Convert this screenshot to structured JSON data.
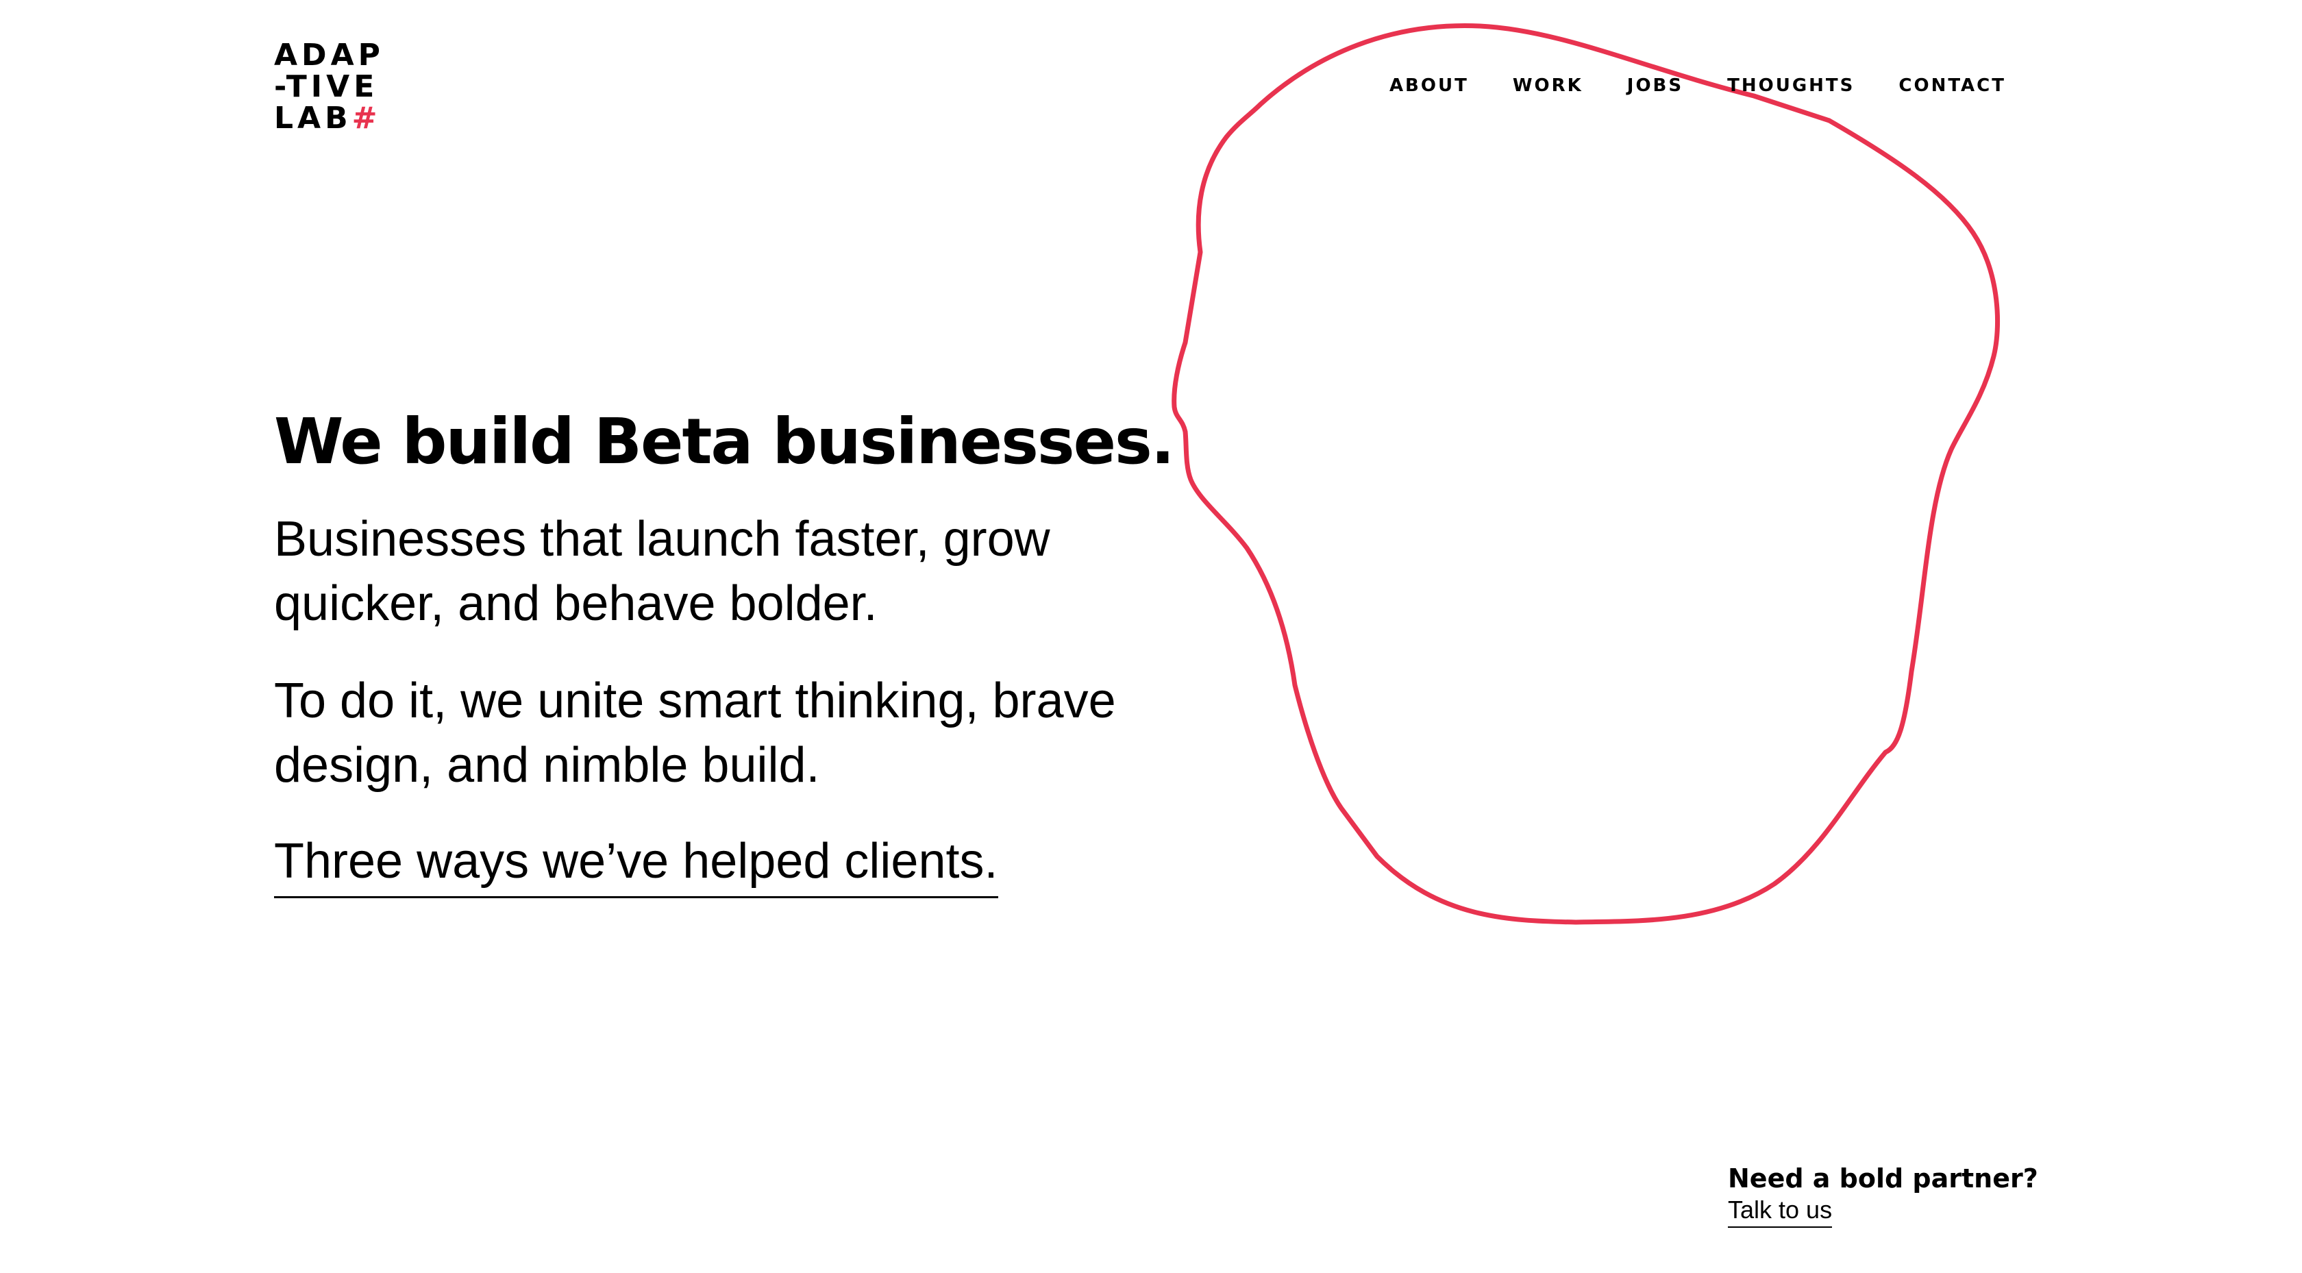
{
  "brand": {
    "logo_lines": [
      "ADAP",
      "-TIVE",
      "LAB"
    ],
    "logo_mark": "#",
    "accent_color": "#e8334f",
    "text_color": "#000000",
    "background_color": "#ffffff"
  },
  "nav": {
    "items": [
      {
        "label": "ABOUT"
      },
      {
        "label": "WORK"
      },
      {
        "label": "JOBS"
      },
      {
        "label": "THOUGHTS"
      },
      {
        "label": "CONTACT"
      }
    ]
  },
  "hero": {
    "headline": "We build Beta businesses.",
    "paragraphs": [
      "Businesses that launch faster, grow quicker, and behave bolder.",
      "To do it, we unite smart thinking, brave design, and nimble build."
    ],
    "link_label": "Three ways we’ve helped clients."
  },
  "decoration": {
    "blob_icon": "outline-blob-shape"
  },
  "cta": {
    "title": "Need a bold partner?",
    "link_label": "Talk to us"
  }
}
